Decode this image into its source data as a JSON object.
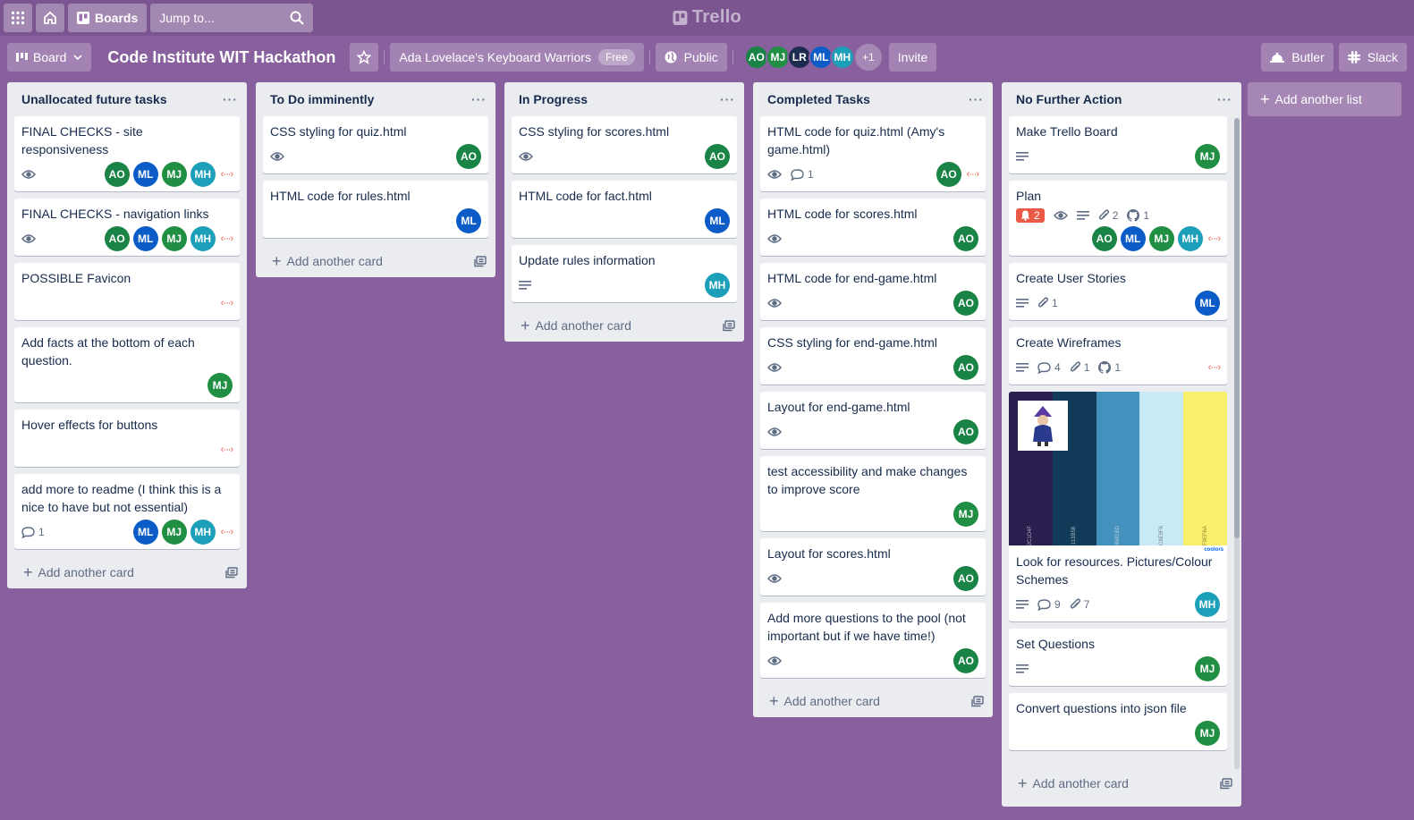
{
  "topnav": {
    "boards_label": "Boards",
    "search_placeholder": "Jump to...",
    "logo_text": "Trello"
  },
  "board_header": {
    "view_label": "Board",
    "title": "Code Institute WIT Hackathon",
    "team_name": "Ada Lovelace's Keyboard Warriors",
    "team_badge": "Free",
    "visibility": "Public",
    "members": [
      "AO",
      "MJ",
      "LR",
      "ML",
      "MH"
    ],
    "more_members": "+1",
    "invite_label": "Invite",
    "butler_label": "Butler",
    "slack_label": "Slack"
  },
  "add_card_label": "Add another card",
  "add_list_label": "Add another list",
  "lists": [
    {
      "title": "Unallocated future tasks",
      "cards": [
        {
          "title": "FINAL CHECKS - site responsiveness",
          "watch": true,
          "members": [
            "AO",
            "ML",
            "MJ",
            "MH"
          ],
          "github": true
        },
        {
          "title": "FINAL CHECKS - navigation links",
          "watch": true,
          "members": [
            "AO",
            "ML",
            "MJ",
            "MH"
          ],
          "github": true
        },
        {
          "title": "POSSIBLE Favicon",
          "github": true
        },
        {
          "title": "Add facts at the bottom of each question.",
          "members": [
            "MJ"
          ]
        },
        {
          "title": "Hover effects for buttons",
          "github": true
        },
        {
          "title": "add more to readme (I think this is a nice to have but not essential)",
          "comments": "1",
          "members": [
            "ML",
            "MJ",
            "MH"
          ],
          "github": true
        }
      ]
    },
    {
      "title": "To Do imminently",
      "cards": [
        {
          "title": "CSS styling for quiz.html",
          "watch": true,
          "members": [
            "AO"
          ]
        },
        {
          "title": "HTML code for rules.html",
          "members": [
            "ML"
          ]
        }
      ]
    },
    {
      "title": "In Progress",
      "cards": [
        {
          "title": "CSS styling for scores.html",
          "watch": true,
          "members": [
            "AO"
          ]
        },
        {
          "title": "HTML code for fact.html",
          "members": [
            "ML"
          ]
        },
        {
          "title": "Update rules information",
          "desc": true,
          "members": [
            "MH"
          ]
        }
      ]
    },
    {
      "title": "Completed Tasks",
      "cards": [
        {
          "title": "HTML code for quiz.html (Amy's game.html)",
          "watch": true,
          "comments": "1",
          "members": [
            "AO"
          ],
          "github": true
        },
        {
          "title": "HTML code for scores.html",
          "watch": true,
          "members": [
            "AO"
          ]
        },
        {
          "title": "HTML code for end-game.html",
          "watch": true,
          "members": [
            "AO"
          ]
        },
        {
          "title": "CSS styling for end-game.html",
          "watch": true,
          "members": [
            "AO"
          ]
        },
        {
          "title": "Layout for end-game.html",
          "watch": true,
          "members": [
            "AO"
          ]
        },
        {
          "title": "test accessibility and make changes to improve score",
          "members": [
            "MJ"
          ]
        },
        {
          "title": "Layout for scores.html",
          "watch": true,
          "members": [
            "AO"
          ]
        },
        {
          "title": "Add more questions to the pool (not important but if we have time!)",
          "watch": true,
          "members": [
            "AO"
          ]
        }
      ]
    },
    {
      "title": "No Further Action",
      "cards": [
        {
          "title": "Make Trello Board",
          "desc": true,
          "members": [
            "MJ"
          ]
        },
        {
          "title": "Plan",
          "notif": "2",
          "watch": true,
          "desc": true,
          "attach": "2",
          "ghcount": "1",
          "members": [
            "AO",
            "ML",
            "MJ",
            "MH"
          ],
          "github": true,
          "wrapAvs": true
        },
        {
          "title": "Create User Stories",
          "desc": true,
          "attach": "1",
          "members": [
            "ML"
          ]
        },
        {
          "title": "Create Wireframes",
          "desc": true,
          "comments": "4",
          "attach": "1",
          "ghcount": "1",
          "github": true
        },
        {
          "title": "Look for resources. Pictures/Colour Schemes",
          "cover": true,
          "desc": true,
          "comments": "9",
          "attach": "7",
          "members": [
            "MH"
          ]
        },
        {
          "title": "Set Questions",
          "desc": true,
          "members": [
            "MJ"
          ]
        },
        {
          "title": "Convert questions into json file",
          "members": [
            "MJ"
          ]
        }
      ]
    }
  ],
  "cover": {
    "colors": [
      "#2c1d4f",
      "#113b58",
      "#4591bd",
      "#c8e9f6",
      "#f9ef6a"
    ],
    "codes": [
      "2C1D4F",
      "113B58",
      "4591BD",
      "C8E9F6",
      "F9EF6A"
    ],
    "brand": "coolors"
  }
}
